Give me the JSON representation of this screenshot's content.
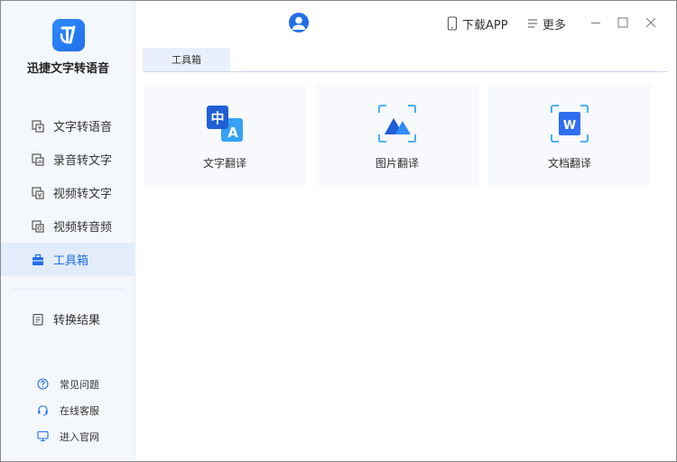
{
  "app": {
    "name": "迅捷文字转语音"
  },
  "sidebar": {
    "items": [
      {
        "label": "文字转语音",
        "icon": "text-to-speech-icon"
      },
      {
        "label": "录音转文字",
        "icon": "recording-to-text-icon"
      },
      {
        "label": "视频转文字",
        "icon": "video-to-text-icon"
      },
      {
        "label": "视频转音频",
        "icon": "video-to-audio-icon"
      },
      {
        "label": "工具箱",
        "icon": "toolbox-icon",
        "active": true
      }
    ],
    "result": {
      "label": "转换结果",
      "icon": "result-doc-icon"
    },
    "links": [
      {
        "label": "常见问题",
        "icon": "question-icon"
      },
      {
        "label": "在线客服",
        "icon": "headset-icon"
      },
      {
        "label": "进入官网",
        "icon": "monitor-icon"
      }
    ]
  },
  "header": {
    "download_label": "下载APP",
    "more_label": "更多"
  },
  "tabs": [
    {
      "label": "工具箱",
      "active": true
    }
  ],
  "cards": [
    {
      "label": "文字翻译",
      "icon": "text-translate-icon"
    },
    {
      "label": "图片翻译",
      "icon": "image-translate-icon"
    },
    {
      "label": "文档翻译",
      "icon": "doc-translate-icon"
    }
  ],
  "colors": {
    "accent": "#1f6fe8",
    "sidebar_bg": "#f4f7fb",
    "active_bg": "#e3ecfa",
    "card_bg": "#f7f9fc"
  },
  "icon_glyphs": {
    "chinese_char": "中",
    "letter_a": "A",
    "letter_w": "W"
  }
}
